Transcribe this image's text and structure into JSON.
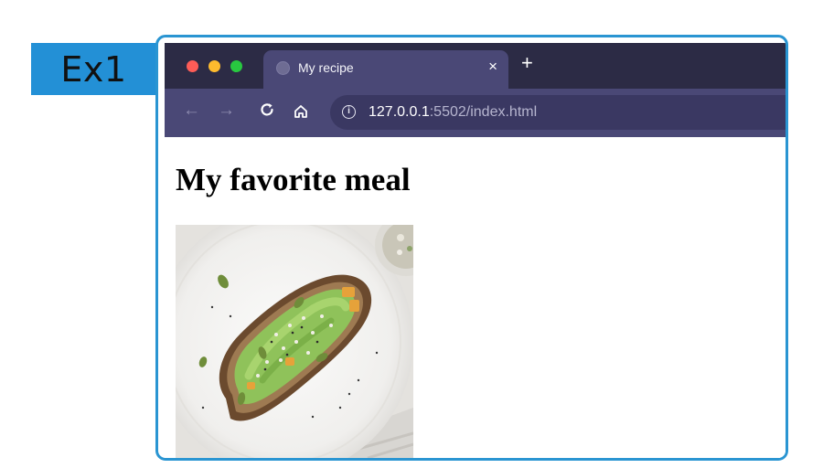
{
  "example_label": "Ex1",
  "browser": {
    "tab": {
      "title": "My recipe",
      "close_glyph": "×"
    },
    "new_tab_glyph": "+",
    "nav": {
      "back": "←",
      "forward": "→",
      "reload": "C"
    },
    "address": {
      "host": "127.0.0.1",
      "path": ":5502/index.html"
    },
    "colors": {
      "tabbar": "#2c2b45",
      "toolbar": "#4a4876",
      "urlbar": "#3a3862"
    }
  },
  "page": {
    "heading": "My favorite meal",
    "image": {
      "icon": "avocado-toast-photo"
    }
  },
  "frame_color": "#2a95d2"
}
